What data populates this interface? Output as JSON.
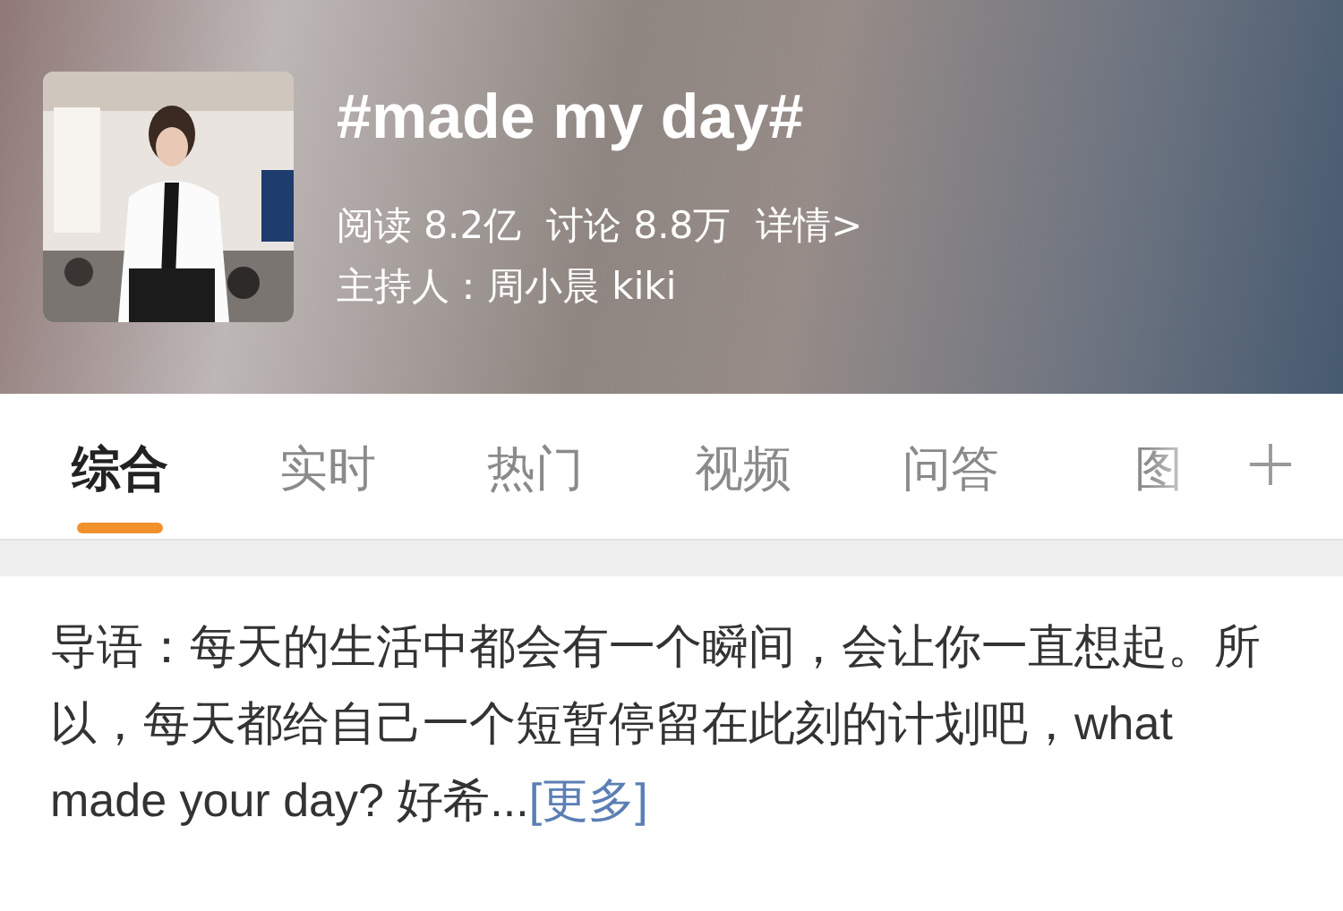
{
  "topic": {
    "title": "#made my day#",
    "reads": "阅读 8.2亿",
    "discussions": "讨论 8.8万",
    "details_link": "详情>",
    "host": "主持人：周小晨 kiki"
  },
  "tabs": [
    {
      "label": "综合",
      "selected": true
    },
    {
      "label": "实时",
      "selected": false
    },
    {
      "label": "热门",
      "selected": false
    },
    {
      "label": "视频",
      "selected": false
    },
    {
      "label": "问答",
      "selected": false
    },
    {
      "label": "图",
      "selected": false
    }
  ],
  "intro": {
    "text": "导语：每天的生活中都会有一个瞬间，会让你一直想起。所以，每天都给自己一个短暂停留在此刻的计划吧，what made your day? 好希...",
    "more_link": "[更多]"
  }
}
